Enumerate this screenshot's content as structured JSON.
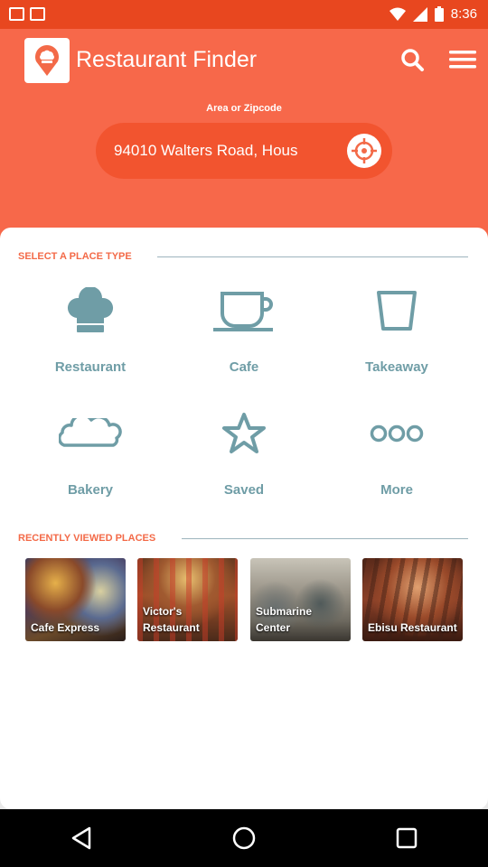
{
  "status_bar": {
    "time": "8:36"
  },
  "header": {
    "app_title": "Restaurant Finder",
    "search_icon": "search-icon",
    "menu_icon": "menu-icon",
    "area_label": "Area or Zipcode",
    "location_value": "94010 Walters Road, Hous"
  },
  "place_types": {
    "section_title": "SELECT A PLACE TYPE",
    "items": [
      {
        "label": "Restaurant",
        "icon": "chef-hat-icon"
      },
      {
        "label": "Cafe",
        "icon": "coffee-cup-icon"
      },
      {
        "label": "Takeaway",
        "icon": "takeaway-cup-icon"
      },
      {
        "label": "Bakery",
        "icon": "bread-icon"
      },
      {
        "label": "Saved",
        "icon": "star-icon"
      },
      {
        "label": "More",
        "icon": "more-icon"
      }
    ]
  },
  "recent": {
    "section_title": "RECENTLY VIEWED PLACES",
    "items": [
      {
        "name": "Cafe Express"
      },
      {
        "name": "Victor's Restaurant"
      },
      {
        "name": "Submarine Center"
      },
      {
        "name": "Ebisu Restaurant"
      }
    ]
  },
  "colors": {
    "header_bg": "#f7684a",
    "status_bar_bg": "#e8471f",
    "accent": "#f36a48",
    "icon_color": "#6f9da6"
  }
}
